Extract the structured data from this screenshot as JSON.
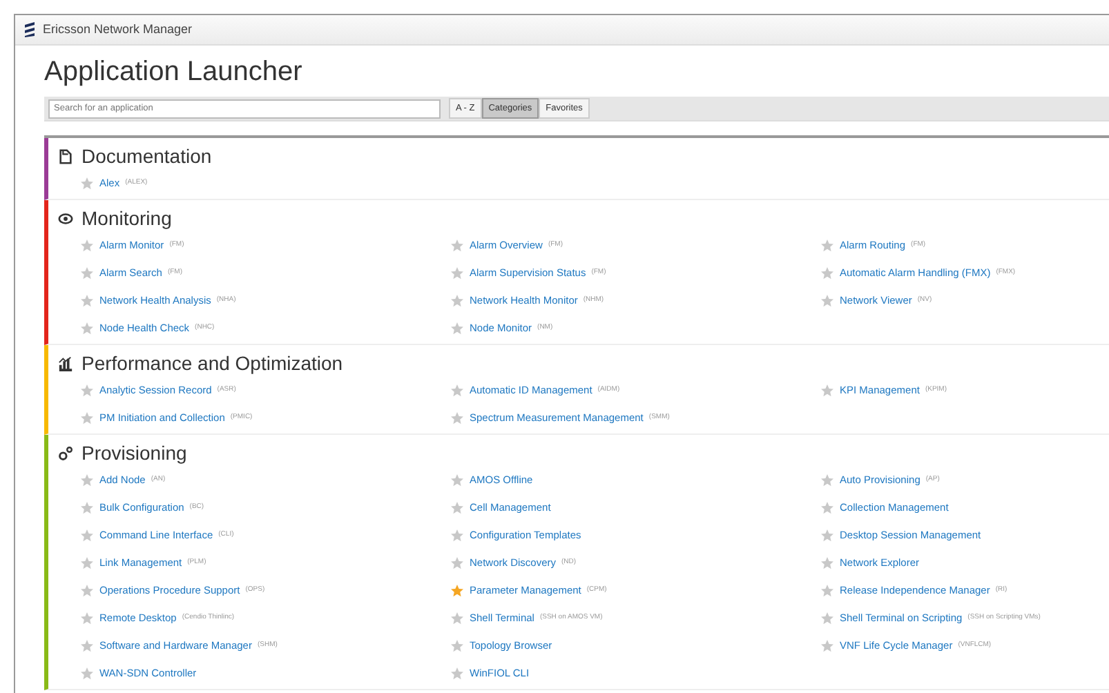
{
  "window": {
    "title": "Ericsson Network Manager"
  },
  "page": {
    "title": "Application Launcher"
  },
  "search": {
    "placeholder": "Search for an application"
  },
  "views": [
    {
      "label": "A - Z",
      "selected": false
    },
    {
      "label": "Categories",
      "selected": true
    },
    {
      "label": "Favorites",
      "selected": false
    }
  ],
  "categories": [
    {
      "title": "Documentation",
      "color": "#9b3b96",
      "apps": [
        {
          "name": "Alex",
          "abbr": "(ALEX)",
          "favorite": false
        }
      ]
    },
    {
      "title": "Monitoring",
      "color": "#e3251b",
      "apps": [
        {
          "name": "Alarm Monitor",
          "abbr": "(FM)",
          "favorite": false
        },
        {
          "name": "Alarm Overview",
          "abbr": "(FM)",
          "favorite": false
        },
        {
          "name": "Alarm Routing",
          "abbr": "(FM)",
          "favorite": false
        },
        {
          "name": "Alarm Search",
          "abbr": "(FM)",
          "favorite": false
        },
        {
          "name": "Alarm Supervision Status",
          "abbr": "(FM)",
          "favorite": false
        },
        {
          "name": "Automatic Alarm Handling (FMX)",
          "abbr": "(FMX)",
          "favorite": false
        },
        {
          "name": "Network Health Analysis",
          "abbr": "(NHA)",
          "favorite": false
        },
        {
          "name": "Network Health Monitor",
          "abbr": "(NHM)",
          "favorite": false
        },
        {
          "name": "Network Viewer",
          "abbr": "(NV)",
          "favorite": false
        },
        {
          "name": "Node Health Check",
          "abbr": "(NHC)",
          "favorite": false
        },
        {
          "name": "Node Monitor",
          "abbr": "(NM)",
          "favorite": false
        }
      ]
    },
    {
      "title": "Performance and Optimization",
      "color": "#f7b900",
      "apps": [
        {
          "name": "Analytic Session Record",
          "abbr": "(ASR)",
          "favorite": false
        },
        {
          "name": "Automatic ID Management",
          "abbr": "(AIDM)",
          "favorite": false
        },
        {
          "name": "KPI Management",
          "abbr": "(KPIM)",
          "favorite": false
        },
        {
          "name": "PM Initiation and Collection",
          "abbr": "(PMIC)",
          "favorite": false
        },
        {
          "name": "Spectrum Measurement Management",
          "abbr": "(SMM)",
          "favorite": false
        }
      ]
    },
    {
      "title": "Provisioning",
      "color": "#89ba17",
      "apps": [
        {
          "name": "Add Node",
          "abbr": "(AN)",
          "favorite": false
        },
        {
          "name": "AMOS Offline",
          "favorite": false
        },
        {
          "name": "Auto Provisioning",
          "abbr": "(AP)",
          "favorite": false
        },
        {
          "name": "Bulk Configuration",
          "abbr": "(BC)",
          "favorite": false
        },
        {
          "name": "Cell Management",
          "favorite": false
        },
        {
          "name": "Collection Management",
          "favorite": false
        },
        {
          "name": "Command Line Interface",
          "abbr": "(CLI)",
          "favorite": false
        },
        {
          "name": "Configuration Templates",
          "favorite": false
        },
        {
          "name": "Desktop Session Management",
          "favorite": false
        },
        {
          "name": "Link Management",
          "abbr": "(PLM)",
          "favorite": false
        },
        {
          "name": "Network Discovery",
          "abbr": "(ND)",
          "favorite": false
        },
        {
          "name": "Network Explorer",
          "favorite": false
        },
        {
          "name": "Operations Procedure Support",
          "abbr": "(OPS)",
          "favorite": false
        },
        {
          "name": "Parameter Management",
          "abbr": "(CPM)",
          "favorite": true
        },
        {
          "name": "Release Independence Manager",
          "abbr": "(RI)",
          "favorite": false
        },
        {
          "name": "Remote Desktop",
          "abbr": "(Cendio Thinlinc)",
          "favorite": false
        },
        {
          "name": "Shell Terminal",
          "abbr": "(SSH on AMOS VM)",
          "favorite": false
        },
        {
          "name": "Shell Terminal on Scripting",
          "abbr": "(SSH on Scripting VMs)",
          "favorite": false
        },
        {
          "name": "Software and Hardware Manager",
          "abbr": "(SHM)",
          "favorite": false
        },
        {
          "name": "Topology Browser",
          "favorite": false
        },
        {
          "name": "VNF Life Cycle Manager",
          "abbr": "(VNFLCM)",
          "favorite": false
        },
        {
          "name": "WAN-SDN Controller",
          "favorite": false
        },
        {
          "name": "WinFIOL CLI",
          "favorite": false
        }
      ]
    }
  ]
}
